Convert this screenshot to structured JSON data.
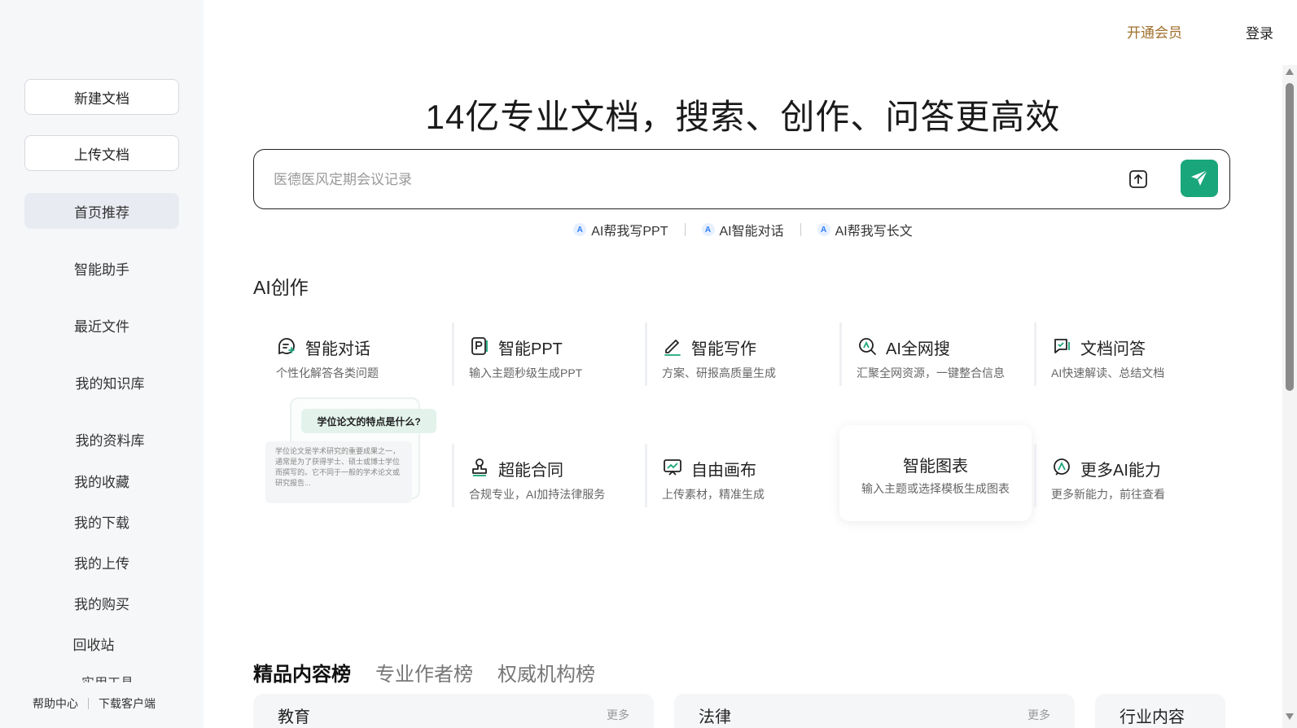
{
  "sidebar": {
    "new_doc": "新建文档",
    "upload_doc": "上传文档",
    "items": [
      {
        "label": "首页推荐",
        "active": true
      },
      {
        "label": "智能助手"
      },
      {
        "label": "最近文件"
      },
      {
        "label": "我的知识库"
      },
      {
        "label": "我的资料库"
      },
      {
        "label": "我的收藏"
      },
      {
        "label": "我的下载"
      },
      {
        "label": "我的上传"
      },
      {
        "label": "我的购买"
      },
      {
        "label": "回收站"
      }
    ],
    "cutoff_label": "实用工具",
    "footer": {
      "help": "帮助中心",
      "download_client": "下载客户端"
    }
  },
  "header": {
    "vip": "开通会员",
    "login": "登录"
  },
  "hero": {
    "title": "14亿专业文档，搜索、创作、问答更高效",
    "search_placeholder": "医德医风定期会议记录",
    "quick_links": [
      "AI帮我写PPT",
      "AI智能对话",
      "AI帮我写长文"
    ]
  },
  "ai_section": {
    "title": "AI创作",
    "cards": [
      {
        "icon": "chat-plus-icon",
        "title": "智能对话",
        "desc": "个性化解答各类问题"
      },
      {
        "icon": "ppt-icon",
        "title": "智能PPT",
        "desc": "输入主题秒级生成PPT"
      },
      {
        "icon": "pen-icon",
        "title": "智能写作",
        "desc": "方案、研报高质量生成"
      },
      {
        "icon": "web-search-icon",
        "title": "AI全网搜",
        "desc": "汇聚全网资源，一键整合信息"
      },
      {
        "icon": "doc-qa-icon",
        "title": "文档问答",
        "desc": "AI快速解读、总结文档"
      },
      {
        "icon": "stamp-icon",
        "title": "超能合同",
        "desc": "合规专业，AI加持法律服务"
      },
      {
        "icon": "canvas-icon",
        "title": "自由画布",
        "desc": "上传素材，精准生成"
      },
      {
        "icon": "chart-icon",
        "title": "智能图表",
        "desc": "输入主题或选择模板生成图表"
      },
      {
        "icon": "more-ai-icon",
        "title": "更多AI能力",
        "desc": "更多新能力，前往查看"
      }
    ],
    "preview": {
      "question": "学位论文的特点是什么?",
      "answer": "学位论文是学术研究的重要成果之一，通常是为了获得学士、硕士或博士学位而撰写的。它不同于一般的学术论文或研究报告..."
    }
  },
  "rankings": {
    "tabs": [
      "精品内容榜",
      "专业作者榜",
      "权威机构榜"
    ],
    "panels": [
      {
        "title": "教育",
        "more": "更多"
      },
      {
        "title": "法律",
        "more": "更多"
      },
      {
        "title": "行业内容"
      }
    ]
  },
  "colors": {
    "accent": "#1aa67b",
    "vip": "#a06f2b",
    "sidebar_bg": "#f6f7f9"
  }
}
